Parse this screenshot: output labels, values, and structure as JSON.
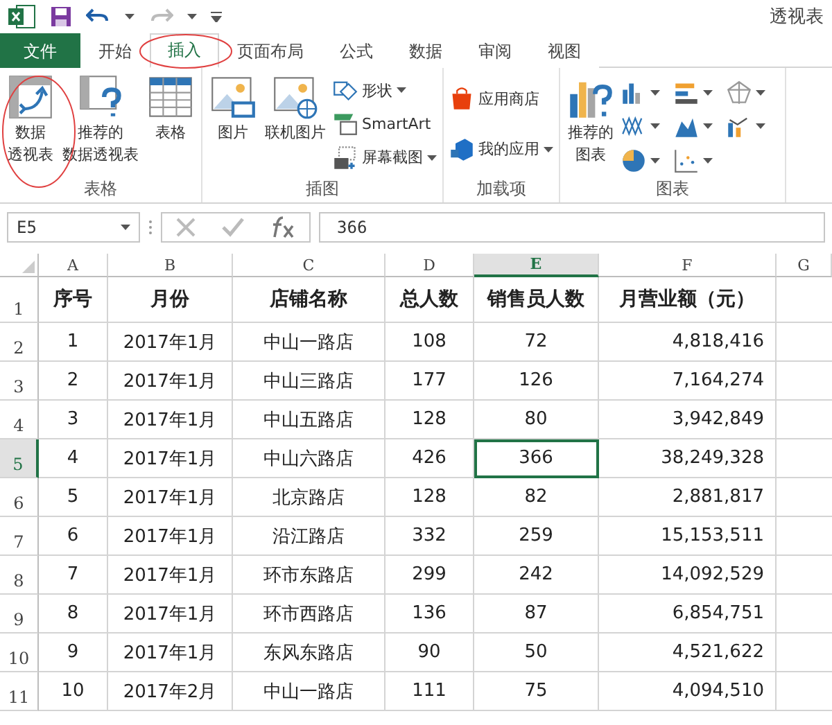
{
  "title": "透视表",
  "tabs": [
    {
      "label": "文件",
      "kind": "file",
      "selected": false
    },
    {
      "label": "开始",
      "kind": "tab",
      "selected": false
    },
    {
      "label": "插入",
      "kind": "tab",
      "selected": true
    },
    {
      "label": "页面布局",
      "kind": "tab",
      "selected": false
    },
    {
      "label": "公式",
      "kind": "tab",
      "selected": false
    },
    {
      "label": "数据",
      "kind": "tab",
      "selected": false
    },
    {
      "label": "审阅",
      "kind": "tab",
      "selected": false
    },
    {
      "label": "视图",
      "kind": "tab",
      "selected": false
    }
  ],
  "ribbon_groups": [
    {
      "label": "表格",
      "items": [
        {
          "kind": "large",
          "lines": [
            "数据",
            "透视表"
          ]
        },
        {
          "kind": "large",
          "lines": [
            "推荐的",
            "数据透视表"
          ]
        },
        {
          "kind": "large",
          "lines": [
            "表格"
          ]
        }
      ]
    },
    {
      "label": "插图",
      "items": [
        {
          "kind": "large",
          "lines": [
            "图片"
          ]
        },
        {
          "kind": "large",
          "lines": [
            "联机图片"
          ]
        },
        {
          "kind": "stack",
          "entries": [
            {
              "label": "形状",
              "dropdown": true
            },
            {
              "label": "SmartArt",
              "dropdown": false
            },
            {
              "label": "屏幕截图",
              "dropdown": true
            }
          ]
        }
      ]
    },
    {
      "label": "加载项",
      "items": [
        {
          "kind": "stack",
          "entries": [
            {
              "label": "应用商店",
              "dropdown": false
            },
            {
              "label": "我的应用",
              "dropdown": true
            }
          ]
        }
      ]
    },
    {
      "label": "图表",
      "items": [
        {
          "kind": "large",
          "lines": [
            "推荐的",
            "图表"
          ]
        },
        {
          "kind": "charts"
        }
      ]
    }
  ],
  "name_box": "E5",
  "formula": "366",
  "columns": [
    {
      "label": "A",
      "selected": false
    },
    {
      "label": "B",
      "selected": false
    },
    {
      "label": "C",
      "selected": false
    },
    {
      "label": "D",
      "selected": false
    },
    {
      "label": "E",
      "selected": true
    },
    {
      "label": "F",
      "selected": false
    },
    {
      "label": "G",
      "selected": false
    }
  ],
  "header_row": {
    "number": "1",
    "cells": [
      "序号",
      "月份",
      "店铺名称",
      "总人数",
      "销售员人数",
      "月营业额（元）"
    ]
  },
  "rows": [
    {
      "number": "2",
      "selected": false,
      "cells": [
        "1",
        "2017年1月",
        "中山一路店",
        "108",
        "72",
        "4,818,416"
      ]
    },
    {
      "number": "3",
      "selected": false,
      "cells": [
        "2",
        "2017年1月",
        "中山三路店",
        "177",
        "126",
        "7,164,274"
      ]
    },
    {
      "number": "4",
      "selected": false,
      "cells": [
        "3",
        "2017年1月",
        "中山五路店",
        "128",
        "80",
        "3,942,849"
      ]
    },
    {
      "number": "5",
      "selected": true,
      "cells": [
        "4",
        "2017年1月",
        "中山六路店",
        "426",
        "366",
        "38,249,328"
      ]
    },
    {
      "number": "6",
      "selected": false,
      "cells": [
        "5",
        "2017年1月",
        "北京路店",
        "128",
        "82",
        "2,881,817"
      ]
    },
    {
      "number": "7",
      "selected": false,
      "cells": [
        "6",
        "2017年1月",
        "沿江路店",
        "332",
        "259",
        "15,153,511"
      ]
    },
    {
      "number": "8",
      "selected": false,
      "cells": [
        "7",
        "2017年1月",
        "环市东路店",
        "299",
        "242",
        "14,092,529"
      ]
    },
    {
      "number": "9",
      "selected": false,
      "cells": [
        "8",
        "2017年1月",
        "环市西路店",
        "136",
        "87",
        "6,854,751"
      ]
    },
    {
      "number": "10",
      "selected": false,
      "cells": [
        "9",
        "2017年1月",
        "东风东路店",
        "90",
        "50",
        "4,521,622"
      ]
    },
    {
      "number": "11",
      "selected": false,
      "cells": [
        "10",
        "2017年2月",
        "中山一路店",
        "111",
        "75",
        "4,094,510"
      ]
    }
  ]
}
